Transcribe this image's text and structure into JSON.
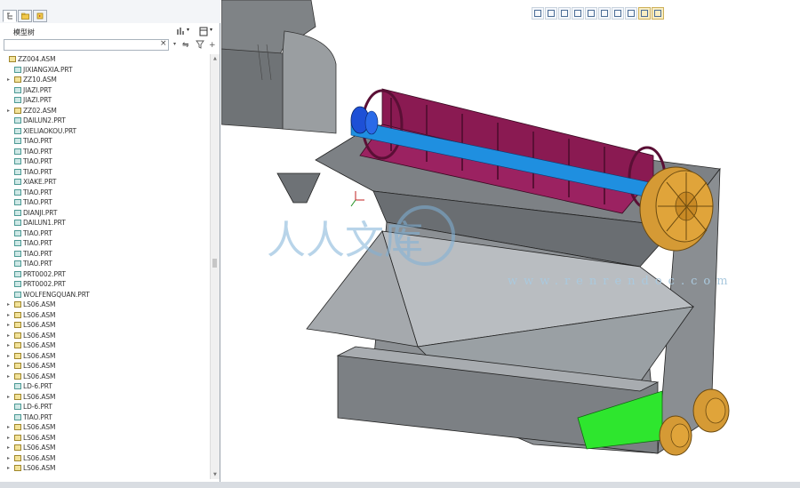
{
  "panel": {
    "tabs": [
      {
        "icon": "model-tree-icon",
        "active": true
      },
      {
        "icon": "folder-browser-icon",
        "active": false
      },
      {
        "icon": "favorites-icon",
        "active": false
      }
    ],
    "title": "模型树",
    "filter": {
      "value": "",
      "placeholder": ""
    }
  },
  "tree": [
    {
      "name": "ZZ004.ASM",
      "type": "asm",
      "level": 0,
      "expandable": false
    },
    {
      "name": "JIXIANGXIA.PRT",
      "type": "prt",
      "level": 1,
      "expandable": false
    },
    {
      "name": "ZZ10.ASM",
      "type": "asm",
      "level": 1,
      "expandable": true
    },
    {
      "name": "JIAZI.PRT",
      "type": "prt",
      "level": 1,
      "expandable": false
    },
    {
      "name": "JIAZI.PRT",
      "type": "prt",
      "level": 1,
      "expandable": false
    },
    {
      "name": "ZZ02.ASM",
      "type": "asm",
      "level": 1,
      "expandable": true
    },
    {
      "name": "DAILUN2.PRT",
      "type": "prt",
      "level": 1,
      "expandable": false
    },
    {
      "name": "XIELIAOKOU.PRT",
      "type": "prt",
      "level": 1,
      "expandable": false
    },
    {
      "name": "TIAO.PRT",
      "type": "prt",
      "level": 1,
      "expandable": false
    },
    {
      "name": "TIAO.PRT",
      "type": "prt",
      "level": 1,
      "expandable": false
    },
    {
      "name": "TIAO.PRT",
      "type": "prt",
      "level": 1,
      "expandable": false
    },
    {
      "name": "TIAO.PRT",
      "type": "prt",
      "level": 1,
      "expandable": false
    },
    {
      "name": "XIAKE.PRT",
      "type": "prt",
      "level": 1,
      "expandable": false
    },
    {
      "name": "TIAO.PRT",
      "type": "prt",
      "level": 1,
      "expandable": false
    },
    {
      "name": "TIAO.PRT",
      "type": "prt",
      "level": 1,
      "expandable": false
    },
    {
      "name": "DIANJI.PRT",
      "type": "prt",
      "level": 1,
      "expandable": false
    },
    {
      "name": "DAILUN1.PRT",
      "type": "prt",
      "level": 1,
      "expandable": false
    },
    {
      "name": "TIAO.PRT",
      "type": "prt",
      "level": 1,
      "expandable": false
    },
    {
      "name": "TIAO.PRT",
      "type": "prt",
      "level": 1,
      "expandable": false
    },
    {
      "name": "TIAO.PRT",
      "type": "prt",
      "level": 1,
      "expandable": false
    },
    {
      "name": "TIAO.PRT",
      "type": "prt",
      "level": 1,
      "expandable": false
    },
    {
      "name": "PRT0002.PRT",
      "type": "prt",
      "level": 1,
      "expandable": false
    },
    {
      "name": "PRT0002.PRT",
      "type": "prt",
      "level": 1,
      "expandable": false
    },
    {
      "name": "WOLFENGQUAN.PRT",
      "type": "prt",
      "level": 1,
      "expandable": false
    },
    {
      "name": "LS06.ASM",
      "type": "asm",
      "level": 1,
      "expandable": true
    },
    {
      "name": "LS06.ASM",
      "type": "asm",
      "level": 1,
      "expandable": true
    },
    {
      "name": "LS06.ASM",
      "type": "asm",
      "level": 1,
      "expandable": true
    },
    {
      "name": "LS06.ASM",
      "type": "asm",
      "level": 1,
      "expandable": true
    },
    {
      "name": "LS06.ASM",
      "type": "asm",
      "level": 1,
      "expandable": true
    },
    {
      "name": "LS06.ASM",
      "type": "asm",
      "level": 1,
      "expandable": true
    },
    {
      "name": "LS06.ASM",
      "type": "asm",
      "level": 1,
      "expandable": true
    },
    {
      "name": "LS06.ASM",
      "type": "asm",
      "level": 1,
      "expandable": true
    },
    {
      "name": "LD-6.PRT",
      "type": "prt",
      "level": 1,
      "expandable": false
    },
    {
      "name": "LS06.ASM",
      "type": "asm",
      "level": 1,
      "expandable": true
    },
    {
      "name": "LD-6.PRT",
      "type": "prt",
      "level": 1,
      "expandable": false
    },
    {
      "name": "TIAO.PRT",
      "type": "prt",
      "level": 1,
      "expandable": false
    },
    {
      "name": "LS06.ASM",
      "type": "asm",
      "level": 1,
      "expandable": true
    },
    {
      "name": "LS06.ASM",
      "type": "asm",
      "level": 1,
      "expandable": true
    },
    {
      "name": "LS06.ASM",
      "type": "asm",
      "level": 1,
      "expandable": true
    },
    {
      "name": "LS06.ASM",
      "type": "asm",
      "level": 1,
      "expandable": true
    },
    {
      "name": "LS06.ASM",
      "type": "asm",
      "level": 1,
      "expandable": true
    }
  ],
  "viewport": {
    "toolbar": [
      "zoom-window-icon",
      "zoom-in-icon",
      "zoom-out-icon",
      "refit-icon",
      "repaint-icon",
      "orientation-icon",
      "saved-views-icon",
      "display-style-icon",
      "datum-display-icon",
      "spin-center-icon"
    ],
    "watermark": {
      "brand": "人人文库",
      "url": "www.renrendoc.com"
    },
    "colors": {
      "frame": "#8f9396",
      "drum": "#8a1a52",
      "shaft": "#1f8fe0",
      "pulley": "#e0a43a",
      "motor": "#2ee62e",
      "hub": "#1e50d6"
    }
  }
}
